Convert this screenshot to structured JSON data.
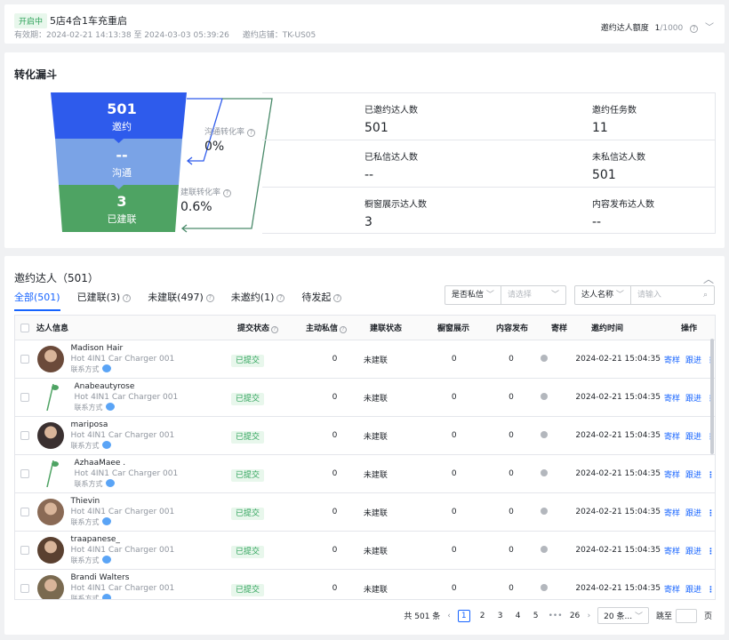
{
  "header": {
    "status": "开启中",
    "title": "5店4合1车充重启",
    "validity": "有效期：2024-02-21 14:13:38 至 2024-03-03 05:39:26",
    "store": "邀约店铺：TK-US05",
    "quota_label": "邀约达人额度",
    "quota_used": "1",
    "quota_total": "/1000"
  },
  "funnel": {
    "title": "转化漏斗",
    "stages": [
      {
        "value": "501",
        "label": "邀约",
        "color": "#2e5bec"
      },
      {
        "value": "--",
        "label": "沟通",
        "color": "#7aa3e6"
      },
      {
        "value": "3",
        "label": "已建联",
        "color": "#4ea363"
      }
    ],
    "rates": [
      {
        "label": "沟通转化率",
        "value": "0%"
      },
      {
        "label": "建联转化率",
        "value": "0.6%"
      }
    ],
    "stats": [
      {
        "label": "已邀约达人数",
        "value": "501"
      },
      {
        "label": "邀约任务数",
        "value": "11"
      },
      {
        "label": "已私信达人数",
        "value": "--"
      },
      {
        "label": "未私信达人数",
        "value": "501"
      },
      {
        "label": "橱窗展示达人数",
        "value": "3"
      },
      {
        "label": "内容发布达人数",
        "value": "--"
      }
    ]
  },
  "list": {
    "title": "邀约达人（501）",
    "tabs": [
      {
        "label": "全部(501)",
        "help": false
      },
      {
        "label": "已建联(3)",
        "help": true
      },
      {
        "label": "未建联(497)",
        "help": true
      },
      {
        "label": "未邀约(1)",
        "help": true
      },
      {
        "label": "待发起",
        "help": true
      }
    ],
    "filters": {
      "dm_label": "是否私信",
      "dm_placeholder": "请选择",
      "name_label": "达人名称",
      "name_placeholder": "请输入"
    },
    "columns": {
      "info": "达人信息",
      "submit": "提交状态",
      "dm": "主动私信",
      "conn": "建联状态",
      "show": "橱窗展示",
      "pub": "内容发布",
      "sample": "寄样",
      "time": "邀约时间",
      "op": "操作"
    },
    "rows": [
      {
        "name": "Madison Hair",
        "product": "Hot 4IN1 Car Charger 001",
        "contact": "联系方式",
        "submit": "已提交",
        "dm": "0",
        "conn": "未建联",
        "show": "0",
        "pub": "0",
        "time": "2024-02-21 15:04:35",
        "avatar": "photo",
        "avatar_color": "#6b4a3a"
      },
      {
        "name": "Anabeautyrose",
        "product": "Hot 4IN1 Car Charger 001",
        "contact": "联系方式",
        "submit": "已提交",
        "dm": "0",
        "conn": "未建联",
        "show": "0",
        "pub": "0",
        "time": "2024-02-21 15:04:35",
        "avatar": "placeholder",
        "avatar_color": "#4ea363"
      },
      {
        "name": "mariposa",
        "product": "Hot 4IN1 Car Charger 001",
        "contact": "联系方式",
        "submit": "已提交",
        "dm": "0",
        "conn": "未建联",
        "show": "0",
        "pub": "0",
        "time": "2024-02-21 15:04:35",
        "avatar": "photo",
        "avatar_color": "#3a3030"
      },
      {
        "name": "AzhaaMaee .",
        "product": "Hot 4IN1 Car Charger 001",
        "contact": "联系方式",
        "submit": "已提交",
        "dm": "0",
        "conn": "未建联",
        "show": "0",
        "pub": "0",
        "time": "2024-02-21 15:04:35",
        "avatar": "placeholder",
        "avatar_color": "#4ea363"
      },
      {
        "name": "Thievin",
        "product": "Hot 4IN1 Car Charger 001",
        "contact": "联系方式",
        "submit": "已提交",
        "dm": "0",
        "conn": "未建联",
        "show": "0",
        "pub": "0",
        "time": "2024-02-21 15:04:35",
        "avatar": "photo",
        "avatar_color": "#8a6a55"
      },
      {
        "name": "traapanese_",
        "product": "Hot 4IN1 Car Charger 001",
        "contact": "联系方式",
        "submit": "已提交",
        "dm": "0",
        "conn": "未建联",
        "show": "0",
        "pub": "0",
        "time": "2024-02-21 15:04:35",
        "avatar": "photo",
        "avatar_color": "#5a4030"
      },
      {
        "name": "Brandi Walters",
        "product": "Hot 4IN1 Car Charger 001",
        "contact": "联系方式",
        "submit": "已提交",
        "dm": "0",
        "conn": "未建联",
        "show": "0",
        "pub": "0",
        "time": "2024-02-21 15:04:35",
        "avatar": "photo",
        "avatar_color": "#7a6a50"
      }
    ],
    "actions": {
      "sample": "寄样",
      "follow": "跟进",
      "more": "⋮"
    },
    "pagination": {
      "total": "共 501 条",
      "pages": [
        "1",
        "2",
        "3",
        "4",
        "5"
      ],
      "ellipsis": "•••",
      "last": "26",
      "current": "1",
      "page_size": "20 条...",
      "goto_label": "跳至",
      "goto_suffix": "页"
    }
  },
  "colors": {
    "accent": "#1664ff",
    "success": "#2ea25a",
    "funnel_arrow_blue": "#2e5bec",
    "funnel_arrow_green": "#4a8a6a"
  }
}
